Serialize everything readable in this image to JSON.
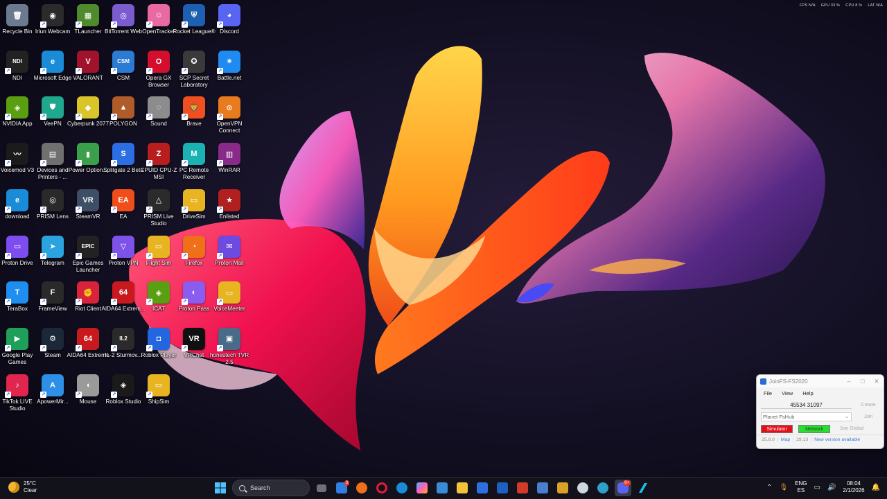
{
  "desktop": {
    "icons": [
      {
        "label": "Recycle Bin",
        "icon": "recycle-bin-icon",
        "color": "#6c7a90",
        "glyph": "🗑"
      },
      {
        "label": "Iriun Webcam",
        "icon": "webcam-icon",
        "color": "#2b2b2b",
        "glyph": "◉"
      },
      {
        "label": "TLauncher",
        "icon": "minecraft-icon",
        "color": "#4f8a2d",
        "glyph": "▦"
      },
      {
        "label": "BitTorrent Web",
        "icon": "bittorrent-icon",
        "color": "#7a5ccf",
        "glyph": "◎"
      },
      {
        "label": "OpenTracker",
        "icon": "opentracker-icon",
        "color": "#e96aa3",
        "glyph": "☺"
      },
      {
        "label": "Rocket League®",
        "icon": "rocket-league-icon",
        "color": "#1d5fb0",
        "glyph": "⛨"
      },
      {
        "label": "Discord",
        "icon": "discord-icon",
        "color": "#5865f2",
        "glyph": "◕"
      },
      {
        "label": "NDI",
        "icon": "ndi-icon",
        "color": "#222222",
        "glyph": "NDI"
      },
      {
        "label": "Microsoft Edge",
        "icon": "edge-icon",
        "color": "#1a8bd6",
        "glyph": "e"
      },
      {
        "label": "VALORANT",
        "icon": "valorant-icon",
        "color": "#a1132c",
        "glyph": "V"
      },
      {
        "label": "CSM",
        "icon": "csm-icon",
        "color": "#2c7bd3",
        "glyph": "CSM"
      },
      {
        "label": "Opera GX Browser",
        "icon": "opera-gx-icon",
        "color": "#d2102d",
        "glyph": "O"
      },
      {
        "label": "SCP Secret Laboratory",
        "icon": "scp-icon",
        "color": "#3a3a3a",
        "glyph": "✪"
      },
      {
        "label": "Battle.net",
        "icon": "battlenet-icon",
        "color": "#1f8bf0",
        "glyph": "✷"
      },
      {
        "label": "NVIDIA App",
        "icon": "nvidia-icon",
        "color": "#5a9f12",
        "glyph": "◈"
      },
      {
        "label": "VeePN",
        "icon": "veepn-icon",
        "color": "#1fa88d",
        "glyph": "⛊"
      },
      {
        "label": "Cyberpunk 2077",
        "icon": "cyberpunk-icon",
        "color": "#d9c42a",
        "glyph": "◆"
      },
      {
        "label": "POLYGON",
        "icon": "polygon-icon",
        "color": "#b05b2a",
        "glyph": "▲"
      },
      {
        "label": "Sound",
        "icon": "sound-icon",
        "color": "#8c8c8c",
        "glyph": "◌"
      },
      {
        "label": "Brave",
        "icon": "brave-icon",
        "color": "#f0501f",
        "glyph": "🦁"
      },
      {
        "label": "OpenVPN Connect",
        "icon": "openvpn-icon",
        "color": "#e97b1f",
        "glyph": "⊙"
      },
      {
        "label": "Voicemod V3",
        "icon": "voicemod-icon",
        "color": "#1b1b1b",
        "glyph": "〰"
      },
      {
        "label": "Devices and Printers - ...",
        "icon": "printer-icon",
        "color": "#707070",
        "glyph": "▤"
      },
      {
        "label": "Power Option...",
        "icon": "battery-icon",
        "color": "#3aa14a",
        "glyph": "▮"
      },
      {
        "label": "Splitgate 2 Beta",
        "icon": "splitgate-icon",
        "color": "#2c6fe4",
        "glyph": "S"
      },
      {
        "label": "CPUID CPU-Z MSI",
        "icon": "cpuz-icon",
        "color": "#b81e1e",
        "glyph": "Z"
      },
      {
        "label": "PC Remote Receiver",
        "icon": "pc-remote-icon",
        "color": "#1ab2b2",
        "glyph": "M"
      },
      {
        "label": "WinRAR",
        "icon": "winrar-icon",
        "color": "#8a2a88",
        "glyph": "▥"
      },
      {
        "label": "download",
        "icon": "edge-icon",
        "color": "#1a8bd6",
        "glyph": "e"
      },
      {
        "label": "PRISM Lens",
        "icon": "prism-lens-icon",
        "color": "#2a2a2a",
        "glyph": "◎"
      },
      {
        "label": "SteamVR",
        "icon": "steamvr-icon",
        "color": "#3d4f66",
        "glyph": "VR"
      },
      {
        "label": "EA",
        "icon": "ea-icon",
        "color": "#f04d1a",
        "glyph": "EA"
      },
      {
        "label": "PRISM Live Studio",
        "icon": "prism-live-icon",
        "color": "#2b2b2b",
        "glyph": "△"
      },
      {
        "label": "DriveSim",
        "icon": "folder-icon",
        "color": "#e8b422",
        "glyph": "▭"
      },
      {
        "label": "Enlisted",
        "icon": "enlisted-icon",
        "color": "#b02020",
        "glyph": "★"
      },
      {
        "label": "Proton Drive",
        "icon": "proton-drive-icon",
        "color": "#7d4df0",
        "glyph": "▭"
      },
      {
        "label": "Telegram",
        "icon": "telegram-icon",
        "color": "#2aa3de",
        "glyph": "➤"
      },
      {
        "label": "Epic Games Launcher",
        "icon": "epic-games-icon",
        "color": "#222222",
        "glyph": "EPIC"
      },
      {
        "label": "Proton VPN",
        "icon": "proton-vpn-icon",
        "color": "#7d52e8",
        "glyph": "▽"
      },
      {
        "label": "Flight Sim",
        "icon": "folder-icon",
        "color": "#e8b422",
        "glyph": "▭"
      },
      {
        "label": "Firefox",
        "icon": "firefox-icon",
        "color": "#f0701a",
        "glyph": "◔"
      },
      {
        "label": "Proton Mail",
        "icon": "proton-mail-icon",
        "color": "#6d4ae0",
        "glyph": "✉"
      },
      {
        "label": "TeraBox",
        "icon": "terabox-icon",
        "color": "#1e8ef0",
        "glyph": "T"
      },
      {
        "label": "FrameView",
        "icon": "frameview-icon",
        "color": "#2a2a2a",
        "glyph": "F"
      },
      {
        "label": "Riot Client",
        "icon": "riot-icon",
        "color": "#d8233a",
        "glyph": "✊"
      },
      {
        "label": "AIDA64 Extrem...",
        "icon": "aida64-icon",
        "color": "#c8191e",
        "glyph": "64"
      },
      {
        "label": "ICAT",
        "icon": "nvidia-icon",
        "color": "#5a9f12",
        "glyph": "◈"
      },
      {
        "label": "Proton Pass",
        "icon": "proton-pass-icon",
        "color": "#8a5cf0",
        "glyph": "◐"
      },
      {
        "label": "VoiceMeeter",
        "icon": "folder-icon",
        "color": "#e8b422",
        "glyph": "▭"
      },
      {
        "label": "Google Play Games",
        "icon": "google-play-icon",
        "color": "#1fa05a",
        "glyph": "▶"
      },
      {
        "label": "Steam",
        "icon": "steam-icon",
        "color": "#1b2838",
        "glyph": "⚙"
      },
      {
        "label": "AIDA64 Extreme",
        "icon": "aida64-icon",
        "color": "#c8191e",
        "glyph": "64"
      },
      {
        "label": "IL-2 Sturmov...",
        "icon": "il2-icon",
        "color": "#2a2a2a",
        "glyph": "IL2"
      },
      {
        "label": "Roblox Player",
        "icon": "roblox-icon",
        "color": "#2366e0",
        "glyph": "◘"
      },
      {
        "label": "VRChat",
        "icon": "vrchat-icon",
        "color": "#101010",
        "glyph": "VR"
      },
      {
        "label": "honestech TVR 2.5",
        "icon": "honestech-icon",
        "color": "#4a6a8a",
        "glyph": "▣"
      },
      {
        "label": "TikTok LIVE Studio",
        "icon": "tiktok-icon",
        "color": "#e0254f",
        "glyph": "♪"
      },
      {
        "label": "ApowerMir...",
        "icon": "apowermirror-icon",
        "color": "#2e8fe8",
        "glyph": "A"
      },
      {
        "label": "Mouse",
        "icon": "mouse-icon",
        "color": "#9a9a9a",
        "glyph": "◖"
      },
      {
        "label": "Roblox Studio",
        "icon": "roblox-studio-icon",
        "color": "#1a1a1a",
        "glyph": "◈"
      },
      {
        "label": "ShipSim",
        "icon": "folder-icon",
        "color": "#e8b422",
        "glyph": "▭"
      }
    ]
  },
  "perf_overlay": [
    "FPS N/A",
    "GPU 33 %",
    "CPU 8 %",
    "LAT N/A"
  ],
  "joinfs": {
    "title": "JoinFS-FS2020",
    "menu": [
      "File",
      "View",
      "Help"
    ],
    "ip_address": "45534 31097",
    "create_label": "Create",
    "server_selected": "Planet FsHub",
    "join_label": "Join",
    "simulator_label": "Simulator",
    "network_label": "Network",
    "join_global_label": "Join Global",
    "status": {
      "version": "25.8.0",
      "map_label": "Map",
      "count": "29,13",
      "update_notice": "New version available"
    }
  },
  "taskbar": {
    "weather_temp": "25°C",
    "weather_desc": "Clear",
    "search_label": "Search",
    "mail_badge": "3",
    "discord_badge": "9+",
    "lang_line1": "ENG",
    "lang_line2": "ES",
    "time": "08:04",
    "date": "2/1/2026"
  }
}
